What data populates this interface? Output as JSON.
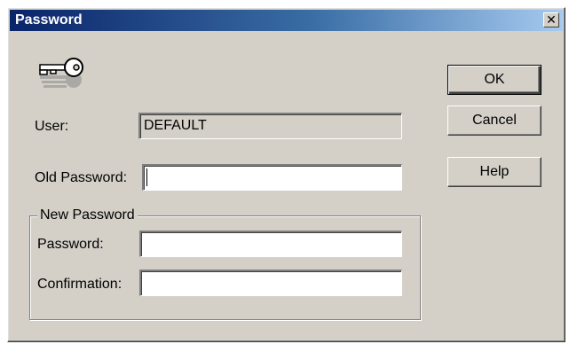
{
  "window": {
    "title": "Password",
    "close_glyph": "✕"
  },
  "icon": "key-icon",
  "user": {
    "label": "User:",
    "value": "DEFAULT"
  },
  "old_password": {
    "label": "Old Password:",
    "value": ""
  },
  "new_password_group": {
    "legend": "New Password",
    "password_label": "Password:",
    "password_value": "",
    "confirmation_label": "Confirmation:",
    "confirmation_value": ""
  },
  "buttons": {
    "ok": "OK",
    "cancel": "Cancel",
    "help": "Help"
  },
  "colors": {
    "face": "#d4d0c8",
    "title_start": "#0a246a",
    "title_end": "#a6caf0"
  }
}
